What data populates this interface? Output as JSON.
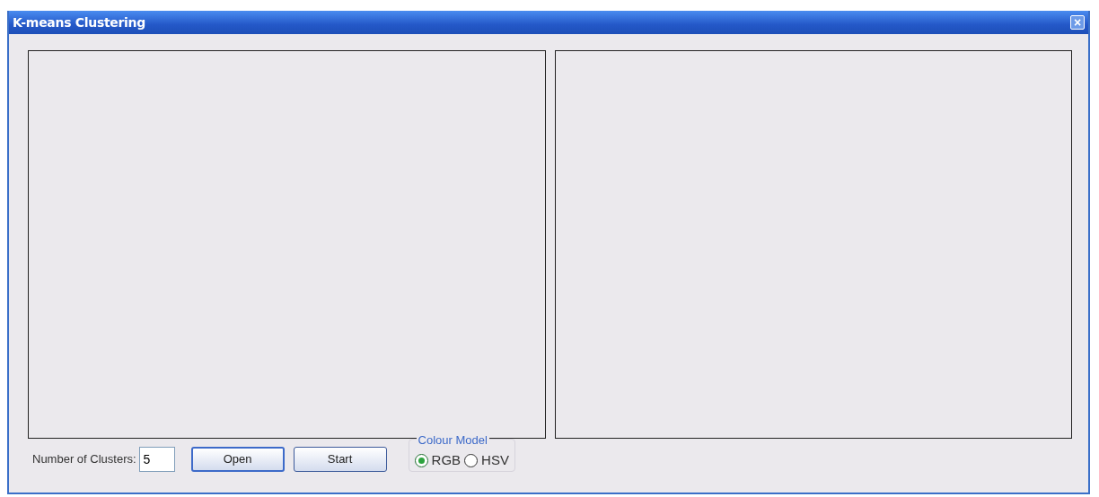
{
  "window": {
    "title": "K-means Clustering",
    "close": "×"
  },
  "panels": [
    {
      "kind": "image-panel"
    },
    {
      "kind": "image-panel"
    }
  ],
  "clusters": {
    "label": "Number of Clusters:",
    "value": "5"
  },
  "buttons": [
    {
      "label": "Open",
      "focused": true
    },
    {
      "label": "Start",
      "focused": false
    }
  ],
  "colour_model": {
    "title": "Colour Model",
    "options": [
      {
        "label": "RGB",
        "selected": true
      },
      {
        "label": "HSV",
        "selected": false
      }
    ]
  }
}
